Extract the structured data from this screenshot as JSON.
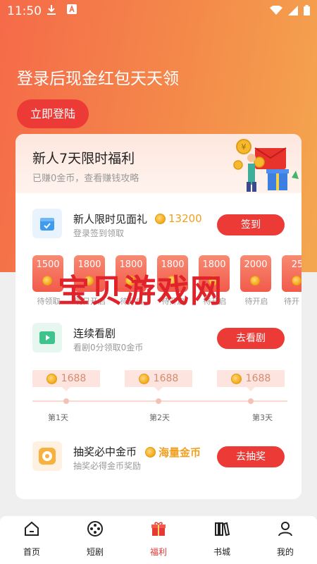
{
  "status_bar": {
    "time": "11:50"
  },
  "hero": {
    "title": "登录后现金红包天天领",
    "login_label": "立即登陆"
  },
  "card": {
    "title": "新人7天限时福利",
    "subtitle": "已赚0金币，查看赚钱攻略",
    "newbie": {
      "title": "新人限时见面礼",
      "coins": "13200",
      "sub": "登录签到领取",
      "button": "签到"
    },
    "days": [
      {
        "amount": "1500",
        "label": "待领取"
      },
      {
        "amount": "1800",
        "label": "明日开启"
      },
      {
        "amount": "1800",
        "label": "待开启"
      },
      {
        "amount": "1800",
        "label": "待开启"
      },
      {
        "amount": "1800",
        "label": "待开启"
      },
      {
        "amount": "2000",
        "label": "待开启"
      },
      {
        "amount": "25",
        "label": "待开"
      }
    ],
    "watch": {
      "title": "连续看剧",
      "sub": "看剧0分领取0金币",
      "button": "去看剧",
      "rewards": [
        "1688",
        "1688",
        "1688"
      ],
      "day_labels": [
        "第1天",
        "第2天",
        "第3天"
      ]
    },
    "lottery": {
      "title": "抽奖必中金币",
      "badge": "海量金币",
      "sub": "抽奖必得金币奖励",
      "button": "去抽奖"
    }
  },
  "nav": [
    {
      "label": "首页",
      "icon": "home-icon",
      "active": false
    },
    {
      "label": "短剧",
      "icon": "film-reel-icon",
      "active": false
    },
    {
      "label": "福利",
      "icon": "gift-icon",
      "active": true
    },
    {
      "label": "书城",
      "icon": "bookshelf-icon",
      "active": false
    },
    {
      "label": "我的",
      "icon": "user-icon",
      "active": false
    }
  ],
  "watermark": "宝贝游戏网",
  "colors": {
    "accent": "#ec3a36",
    "hero_start": "#f56a49",
    "hero_end": "#f4a74f",
    "nav_active": "#e53935",
    "coin_text": "#f0a020"
  }
}
